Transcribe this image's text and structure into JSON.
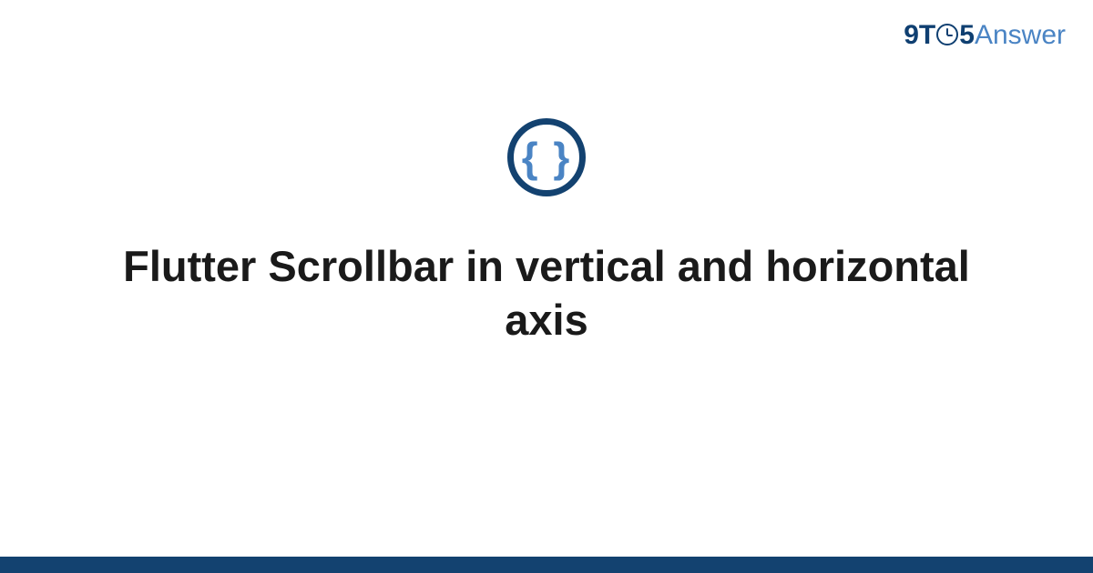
{
  "logo": {
    "prefix": "9T",
    "suffix": "5",
    "answer": "Answer"
  },
  "icon": {
    "braces": "{ }"
  },
  "title": "Flutter Scrollbar in vertical and horizontal axis",
  "colors": {
    "dark_blue": "#134270",
    "light_blue": "#4a84c4"
  }
}
